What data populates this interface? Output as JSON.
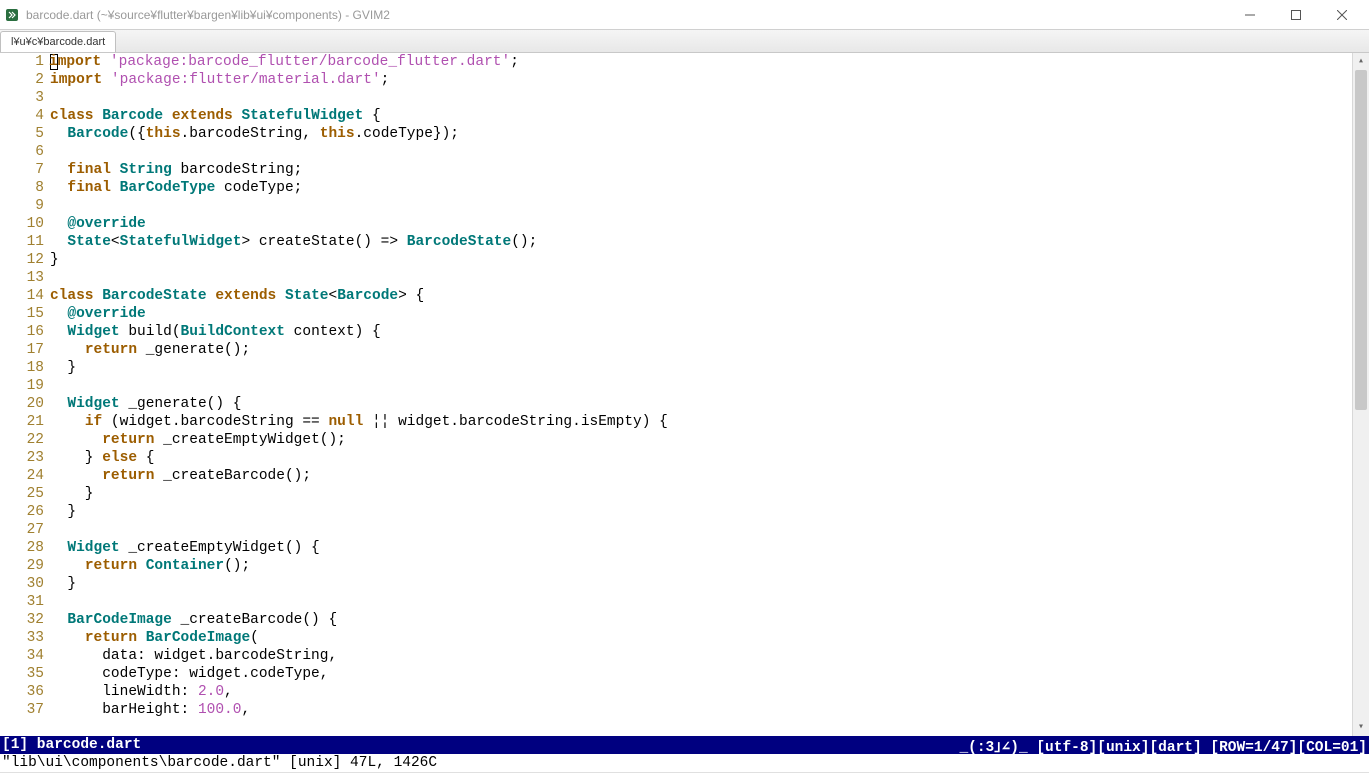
{
  "window": {
    "title": "barcode.dart (~¥source¥flutter¥bargen¥lib¥ui¥components) - GVIM2"
  },
  "tabs": [
    {
      "label": "l¥u¥c¥barcode.dart"
    }
  ],
  "lines": [
    {
      "n": 1,
      "tokens": [
        {
          "c": "cursor",
          "t": ""
        },
        {
          "c": "kw",
          "t": "import"
        },
        {
          "c": "",
          "t": " "
        },
        {
          "c": "str",
          "t": "'package:barcode_flutter/barcode_flutter.dart'"
        },
        {
          "c": "",
          "t": ";"
        }
      ]
    },
    {
      "n": 2,
      "tokens": [
        {
          "c": "kw",
          "t": "import"
        },
        {
          "c": "",
          "t": " "
        },
        {
          "c": "str",
          "t": "'package:flutter/material.dart'"
        },
        {
          "c": "",
          "t": ";"
        }
      ]
    },
    {
      "n": 3,
      "tokens": []
    },
    {
      "n": 4,
      "tokens": [
        {
          "c": "kw",
          "t": "class"
        },
        {
          "c": "",
          "t": " "
        },
        {
          "c": "type",
          "t": "Barcode"
        },
        {
          "c": "",
          "t": " "
        },
        {
          "c": "kw",
          "t": "extends"
        },
        {
          "c": "",
          "t": " "
        },
        {
          "c": "type",
          "t": "StatefulWidget"
        },
        {
          "c": "",
          "t": " {"
        }
      ]
    },
    {
      "n": 5,
      "tokens": [
        {
          "c": "",
          "t": "  "
        },
        {
          "c": "type",
          "t": "Barcode"
        },
        {
          "c": "",
          "t": "({"
        },
        {
          "c": "kw",
          "t": "this"
        },
        {
          "c": "",
          "t": ".barcodeString, "
        },
        {
          "c": "kw",
          "t": "this"
        },
        {
          "c": "",
          "t": ".codeType});"
        }
      ]
    },
    {
      "n": 6,
      "tokens": []
    },
    {
      "n": 7,
      "tokens": [
        {
          "c": "",
          "t": "  "
        },
        {
          "c": "kw",
          "t": "final"
        },
        {
          "c": "",
          "t": " "
        },
        {
          "c": "type",
          "t": "String"
        },
        {
          "c": "",
          "t": " barcodeString;"
        }
      ]
    },
    {
      "n": 8,
      "tokens": [
        {
          "c": "",
          "t": "  "
        },
        {
          "c": "kw",
          "t": "final"
        },
        {
          "c": "",
          "t": " "
        },
        {
          "c": "type",
          "t": "BarCodeType"
        },
        {
          "c": "",
          "t": " codeType;"
        }
      ]
    },
    {
      "n": 9,
      "tokens": []
    },
    {
      "n": 10,
      "tokens": [
        {
          "c": "",
          "t": "  "
        },
        {
          "c": "ann",
          "t": "@override"
        }
      ]
    },
    {
      "n": 11,
      "tokens": [
        {
          "c": "",
          "t": "  "
        },
        {
          "c": "type",
          "t": "State"
        },
        {
          "c": "",
          "t": "<"
        },
        {
          "c": "type",
          "t": "StatefulWidget"
        },
        {
          "c": "",
          "t": "> createState() => "
        },
        {
          "c": "type",
          "t": "BarcodeState"
        },
        {
          "c": "",
          "t": "();"
        }
      ]
    },
    {
      "n": 12,
      "tokens": [
        {
          "c": "",
          "t": "}"
        }
      ]
    },
    {
      "n": 13,
      "tokens": []
    },
    {
      "n": 14,
      "tokens": [
        {
          "c": "kw",
          "t": "class"
        },
        {
          "c": "",
          "t": " "
        },
        {
          "c": "type",
          "t": "BarcodeState"
        },
        {
          "c": "",
          "t": " "
        },
        {
          "c": "kw",
          "t": "extends"
        },
        {
          "c": "",
          "t": " "
        },
        {
          "c": "type",
          "t": "State"
        },
        {
          "c": "",
          "t": "<"
        },
        {
          "c": "type",
          "t": "Barcode"
        },
        {
          "c": "",
          "t": "> {"
        }
      ]
    },
    {
      "n": 15,
      "tokens": [
        {
          "c": "",
          "t": "  "
        },
        {
          "c": "ann",
          "t": "@override"
        }
      ]
    },
    {
      "n": 16,
      "tokens": [
        {
          "c": "",
          "t": "  "
        },
        {
          "c": "type",
          "t": "Widget"
        },
        {
          "c": "",
          "t": " build("
        },
        {
          "c": "type",
          "t": "BuildContext"
        },
        {
          "c": "",
          "t": " context) {"
        }
      ]
    },
    {
      "n": 17,
      "tokens": [
        {
          "c": "",
          "t": "    "
        },
        {
          "c": "kw",
          "t": "return"
        },
        {
          "c": "",
          "t": " _generate();"
        }
      ]
    },
    {
      "n": 18,
      "tokens": [
        {
          "c": "",
          "t": "  }"
        }
      ]
    },
    {
      "n": 19,
      "tokens": []
    },
    {
      "n": 20,
      "tokens": [
        {
          "c": "",
          "t": "  "
        },
        {
          "c": "type",
          "t": "Widget"
        },
        {
          "c": "",
          "t": " _generate() {"
        }
      ]
    },
    {
      "n": 21,
      "tokens": [
        {
          "c": "",
          "t": "    "
        },
        {
          "c": "kw",
          "t": "if"
        },
        {
          "c": "",
          "t": " (widget.barcodeString == "
        },
        {
          "c": "kw",
          "t": "null"
        },
        {
          "c": "",
          "t": " ¦¦ widget.barcodeString.isEmpty) {"
        }
      ]
    },
    {
      "n": 22,
      "tokens": [
        {
          "c": "",
          "t": "      "
        },
        {
          "c": "kw",
          "t": "return"
        },
        {
          "c": "",
          "t": " _createEmptyWidget();"
        }
      ]
    },
    {
      "n": 23,
      "tokens": [
        {
          "c": "",
          "t": "    } "
        },
        {
          "c": "kw",
          "t": "else"
        },
        {
          "c": "",
          "t": " {"
        }
      ]
    },
    {
      "n": 24,
      "tokens": [
        {
          "c": "",
          "t": "      "
        },
        {
          "c": "kw",
          "t": "return"
        },
        {
          "c": "",
          "t": " _createBarcode();"
        }
      ]
    },
    {
      "n": 25,
      "tokens": [
        {
          "c": "",
          "t": "    }"
        }
      ]
    },
    {
      "n": 26,
      "tokens": [
        {
          "c": "",
          "t": "  }"
        }
      ]
    },
    {
      "n": 27,
      "tokens": []
    },
    {
      "n": 28,
      "tokens": [
        {
          "c": "",
          "t": "  "
        },
        {
          "c": "type",
          "t": "Widget"
        },
        {
          "c": "",
          "t": " _createEmptyWidget() {"
        }
      ]
    },
    {
      "n": 29,
      "tokens": [
        {
          "c": "",
          "t": "    "
        },
        {
          "c": "kw",
          "t": "return"
        },
        {
          "c": "",
          "t": " "
        },
        {
          "c": "type",
          "t": "Container"
        },
        {
          "c": "",
          "t": "();"
        }
      ]
    },
    {
      "n": 30,
      "tokens": [
        {
          "c": "",
          "t": "  }"
        }
      ]
    },
    {
      "n": 31,
      "tokens": []
    },
    {
      "n": 32,
      "tokens": [
        {
          "c": "",
          "t": "  "
        },
        {
          "c": "type",
          "t": "BarCodeImage"
        },
        {
          "c": "",
          "t": " _createBarcode() {"
        }
      ]
    },
    {
      "n": 33,
      "tokens": [
        {
          "c": "",
          "t": "    "
        },
        {
          "c": "kw",
          "t": "return"
        },
        {
          "c": "",
          "t": " "
        },
        {
          "c": "type",
          "t": "BarCodeImage"
        },
        {
          "c": "",
          "t": "("
        }
      ]
    },
    {
      "n": 34,
      "tokens": [
        {
          "c": "",
          "t": "      data: widget.barcodeString,"
        }
      ]
    },
    {
      "n": 35,
      "tokens": [
        {
          "c": "",
          "t": "      codeType: widget.codeType,"
        }
      ]
    },
    {
      "n": 36,
      "tokens": [
        {
          "c": "",
          "t": "      lineWidth: "
        },
        {
          "c": "num",
          "t": "2.0"
        },
        {
          "c": "",
          "t": ","
        }
      ]
    },
    {
      "n": 37,
      "tokens": [
        {
          "c": "",
          "t": "      barHeight: "
        },
        {
          "c": "num",
          "t": "100.0"
        },
        {
          "c": "",
          "t": ","
        }
      ]
    }
  ],
  "status": {
    "left": "[1] barcode.dart",
    "right": "_(:3｣∠)_ [utf-8][unix][dart] [ROW=1/47][COL=01]"
  },
  "cmdline": "\"lib\\ui\\components\\barcode.dart\" [unix] 47L, 1426C"
}
